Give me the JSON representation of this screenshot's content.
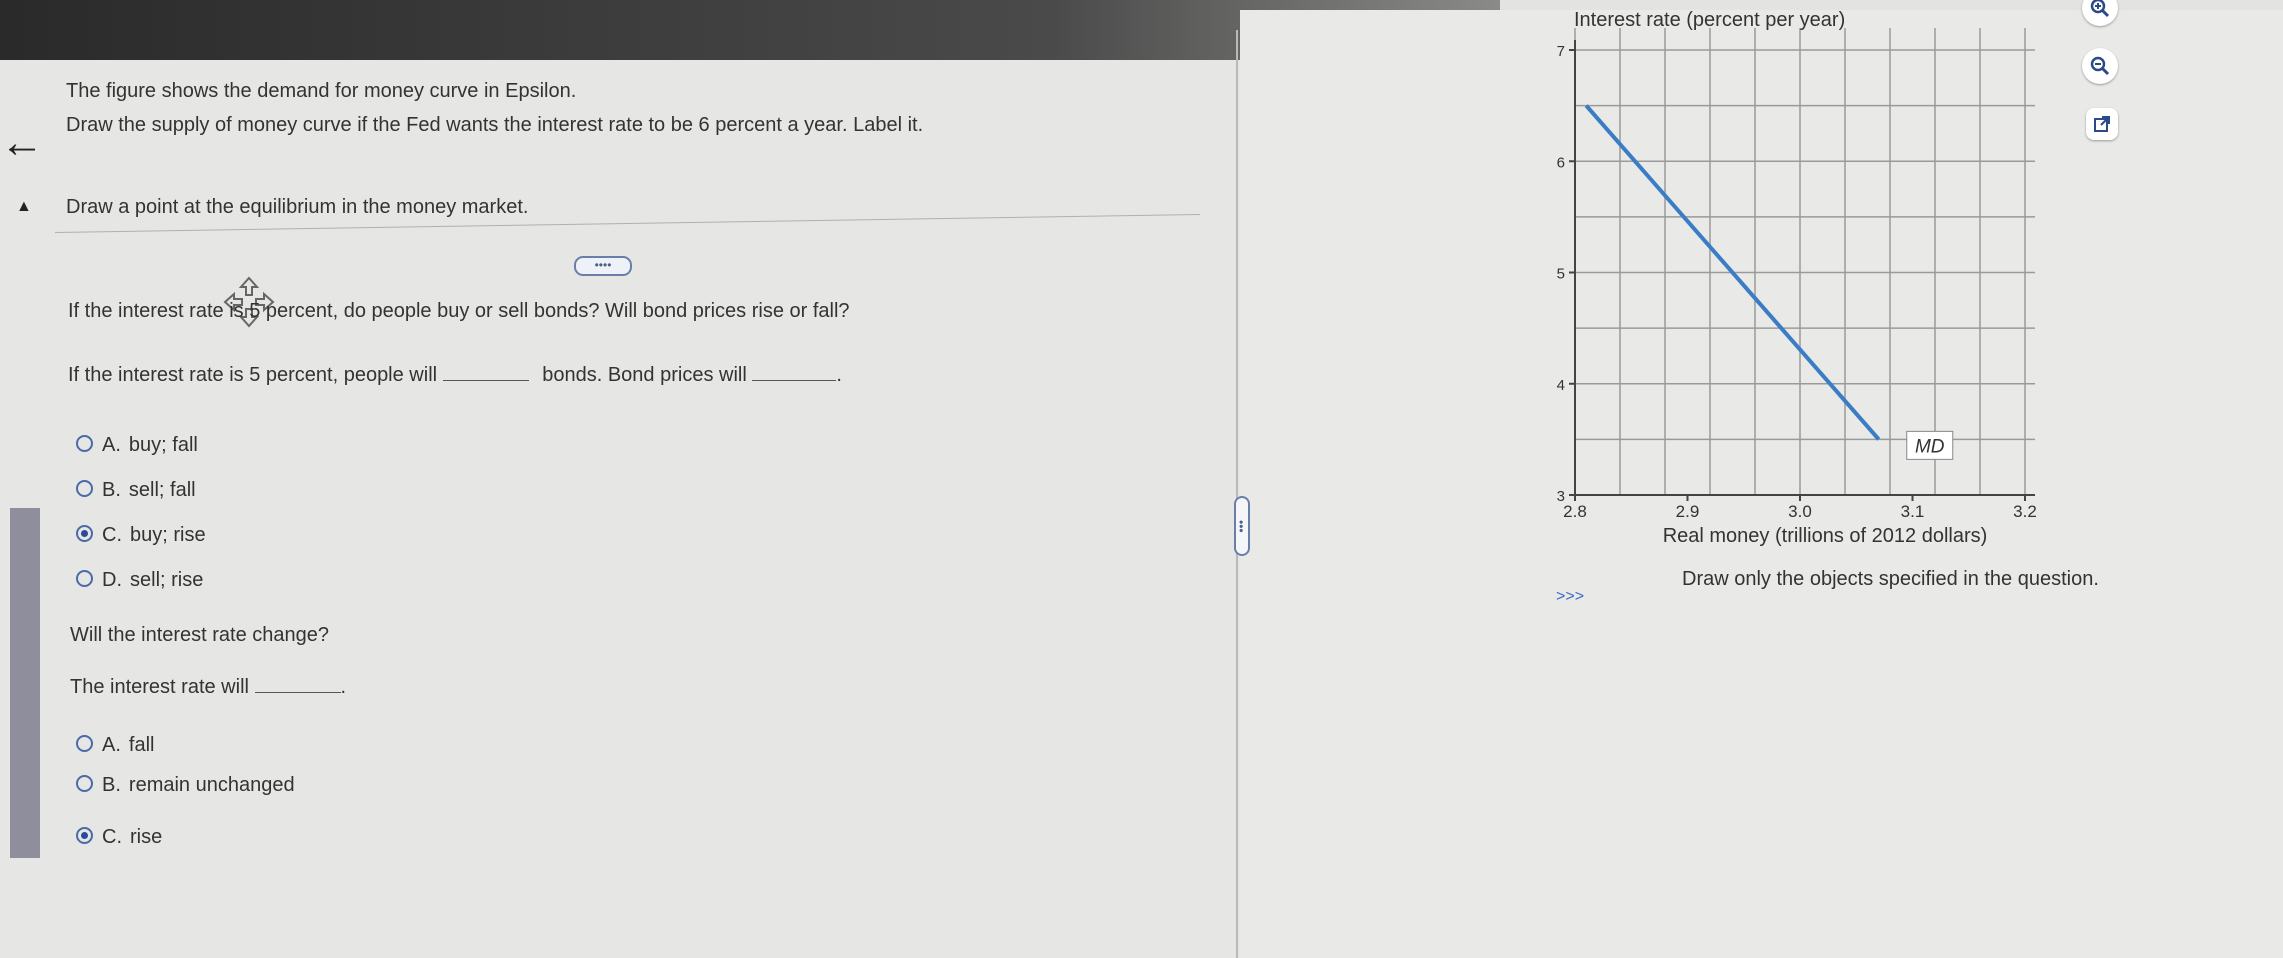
{
  "nav": {
    "back_icon": "arrow-left-icon",
    "collapse_icon": "triangle-up-icon"
  },
  "instructions": {
    "line1": "The figure shows the demand for money curve in Epsilon.",
    "line2": "Draw the supply of money curve if the Fed wants the interest rate to be 6 percent a year. Label it.",
    "line3": "Draw a point at the equilibrium in the money market."
  },
  "more_button_label": "••••",
  "question1": {
    "prompt": "If the interest rate is 5 percent, do people buy or sell bonds? Will bond prices rise or fall?",
    "stem_part1": "If the interest rate is 5 percent, people will",
    "stem_part2": "bonds. Bond prices will",
    "stem_end": ".",
    "options": [
      {
        "letter": "A.",
        "text": "buy; fall",
        "selected": false
      },
      {
        "letter": "B.",
        "text": "sell; fall",
        "selected": false
      },
      {
        "letter": "C.",
        "text": "buy; rise",
        "selected": true
      },
      {
        "letter": "D.",
        "text": "sell; rise",
        "selected": false
      }
    ]
  },
  "question2": {
    "prompt": "Will the interest rate change?",
    "stem_part1": "The interest rate will",
    "stem_end": ".",
    "options": [
      {
        "letter": "A.",
        "text": "fall",
        "selected": false
      },
      {
        "letter": "B.",
        "text": "remain unchanged",
        "selected": false
      },
      {
        "letter": "C.",
        "text": "rise",
        "selected": true
      }
    ]
  },
  "splitter_label": "•••",
  "tools": {
    "zoom_in_icon": "zoom-in-icon",
    "zoom_out_icon": "zoom-out-icon",
    "popout_icon": "external-link-icon"
  },
  "chart_data": {
    "type": "line",
    "ylabel": "Interest rate (percent per year)",
    "xlabel": "Real money (trillions of 2012 dollars)",
    "xlim": [
      2.8,
      3.2
    ],
    "ylim": [
      3,
      7
    ],
    "x_ticks": [
      "2.8",
      "2.9",
      "3.0",
      "3.1",
      "3.2"
    ],
    "y_ticks": [
      "3",
      "4",
      "5",
      "6",
      "7"
    ],
    "grid": true,
    "series": [
      {
        "name": "MD",
        "color": "#3b7dc4",
        "x": [
          2.81,
          3.07
        ],
        "y": [
          6.5,
          3.5
        ]
      }
    ]
  },
  "footer": {
    "arrows": ">>>",
    "note": "Draw only the objects specified in the question."
  }
}
